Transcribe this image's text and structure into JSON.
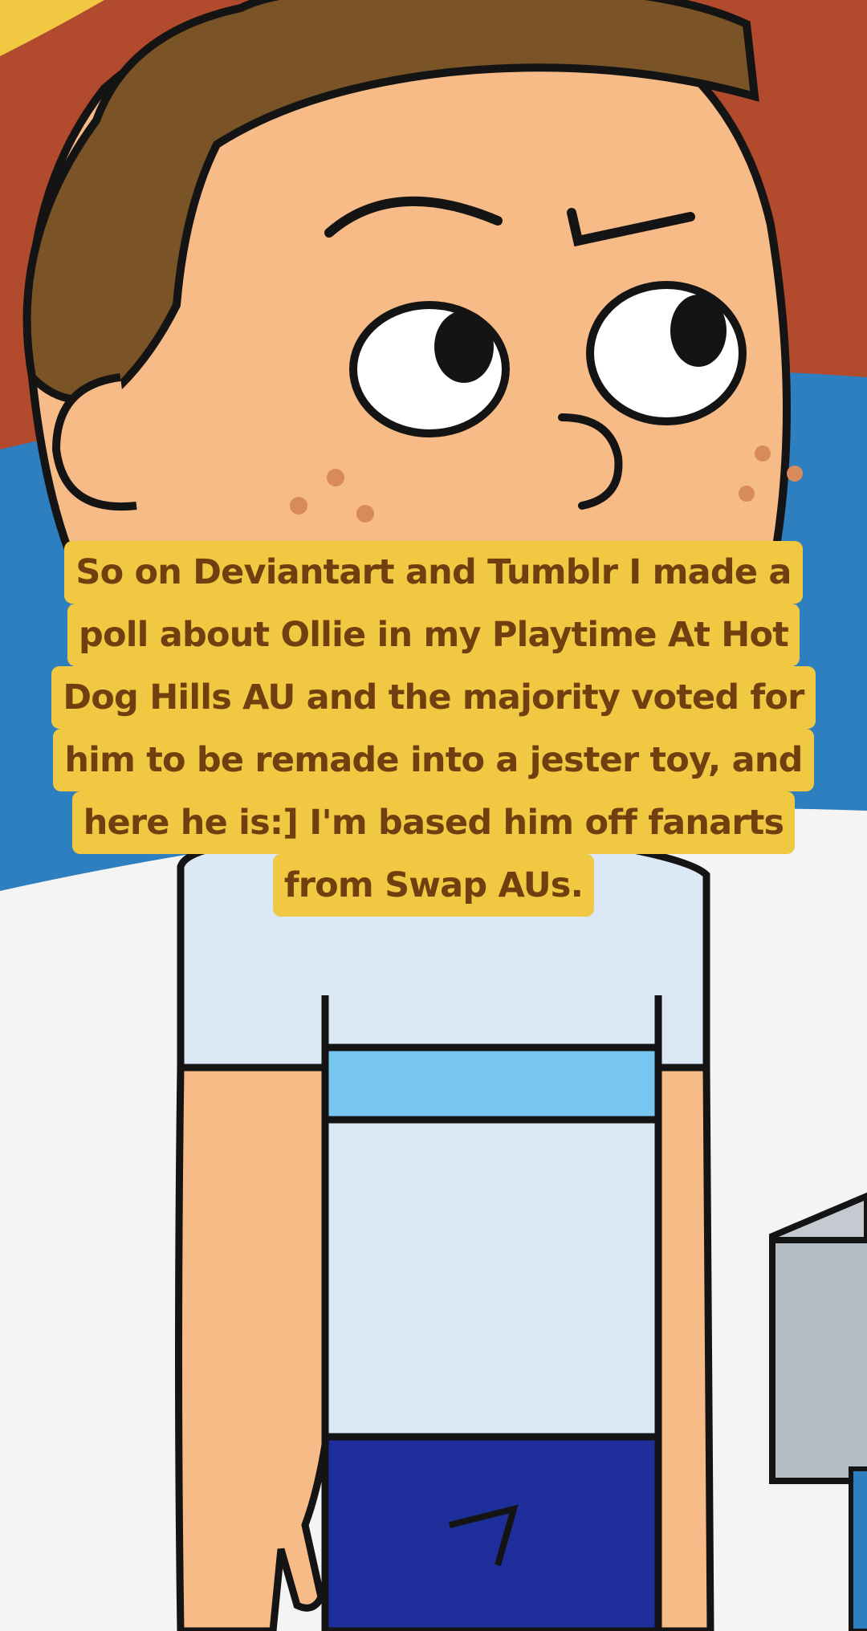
{
  "colors": {
    "background_red": "#b24a2e",
    "background_blue": "#2d7fbf",
    "background_white": "#f4f4f4",
    "hair": "#7a5326",
    "skin": "#f6bb87",
    "freckles": "#d98a5c",
    "outline": "#141414",
    "shirt": "#dbe9f6",
    "shirt_stripe": "#77c6ef",
    "pants": "#1e2e9a",
    "caption_background": "#f1c842",
    "caption_text": "#6f3f10"
  },
  "icons": {
    "character": "cartoon-boy-character",
    "box": "grey-box"
  },
  "caption": {
    "lines": [
      "So on Deviantart and Tumblr I made a",
      "poll about Ollie in my Playtime At Hot",
      "Dog Hills AU and the majority voted for",
      "him to be remade into a jester toy, and",
      "here he is:] I'm based him off fanarts",
      "from Swap AUs."
    ]
  }
}
